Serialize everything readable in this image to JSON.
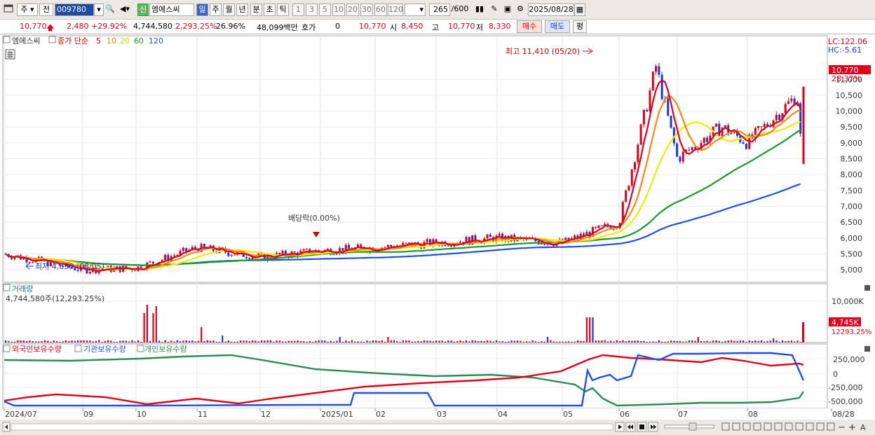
{
  "toolbar": {
    "period_sel": "주",
    "prev_label": "전",
    "stock_code": "009780",
    "badge_sin": "신",
    "stock_name": "엠에스씨",
    "periods": [
      "일",
      "주",
      "월",
      "년",
      "분",
      "초",
      "틱"
    ],
    "intervals": [
      "1",
      "3",
      "5",
      "10",
      "20",
      "30",
      "60",
      "120"
    ],
    "count": "265",
    "count_max": "/600",
    "date": "2025/08/28"
  },
  "quote": {
    "price": "10,770",
    "change": "2,480",
    "change_pct": "+29.92%",
    "volume": "4,744,580",
    "volume_pct": "2,293.25%",
    "turnover": "26.96%",
    "amount": "48,099백만",
    "hoga_label": "호가",
    "hoga_value": "0",
    "price2": "10,770",
    "open_label": "시",
    "open": "8,450",
    "high_label": "고",
    "high": "10,770",
    "low_label": "저",
    "low": "8,330",
    "buy_label": "매수",
    "sell_label": "매도",
    "eval_label": "평"
  },
  "price_panel": {
    "name": "엠에스씨",
    "ma_label": "종가 단순",
    "ma_periods": [
      "5",
      "10",
      "20",
      "60",
      "120"
    ],
    "lc": "LC:122.06",
    "hc": "HC:-5.61",
    "current_tag": "10,770",
    "current_pct": "28.37%",
    "high_note": "최고 11,410 (05/20)",
    "low_note": "최저 4,650 (08/05)",
    "dividend_note": "배당락(0.00%)"
  },
  "volume_panel": {
    "title": "거래량",
    "value": "4,744,580주(12,293.25%)",
    "current_tag": "4,745K",
    "current_pct": "12293.25%"
  },
  "holdings_panel": {
    "legends": [
      "외국인보유수량",
      "기관보유수량",
      "개인보유수량"
    ]
  },
  "x_axis": [
    "2024/07",
    "09",
    "10",
    "11",
    "12",
    "2025/01",
    "02",
    "03",
    "04",
    "05",
    "06",
    "07",
    "08",
    "08/28"
  ],
  "colors": {
    "ma5": "#e0001a",
    "ma10": "#f28a10",
    "ma20": "#f5e800",
    "ma60": "#1a9a2a",
    "ma120": "#2150e0",
    "up": "#e0001a",
    "down": "#1a37d8",
    "foreign": "#e0001a",
    "institution": "#2150e0",
    "individual": "#2e8b57"
  },
  "chart_data": [
    {
      "type": "candlestick",
      "title": "엠에스씨",
      "y_ticks": [
        5000,
        5500,
        6000,
        6500,
        7000,
        7500,
        8000,
        8500,
        9000,
        9500,
        10000,
        10500,
        11000
      ],
      "ylim": [
        4650,
        11800
      ],
      "close_points": [
        [
          "2024/07",
          5500
        ],
        [
          "2024/08",
          5000
        ],
        [
          "2024/09",
          5050
        ],
        [
          "2024/10",
          5700
        ],
        [
          "2024/11",
          5400
        ],
        [
          "2024/12",
          5600
        ],
        [
          "2025/01",
          5700
        ],
        [
          "2025/02",
          5850
        ],
        [
          "2025/03",
          6000
        ],
        [
          "2025/04",
          5850
        ],
        [
          "2025/05",
          6500
        ],
        [
          "2025/05/20",
          11410
        ],
        [
          "2025/06",
          8500
        ],
        [
          "2025/06/20",
          9500
        ],
        [
          "2025/07",
          9000
        ],
        [
          "2025/07/20",
          10500
        ],
        [
          "2025/08",
          8000
        ],
        [
          "2025/08/27",
          8290
        ],
        [
          "2025/08/28",
          10770
        ]
      ],
      "high": {
        "value": 11410,
        "date": "05/20"
      },
      "low": {
        "value": 4650,
        "date": "08/05"
      }
    },
    {
      "type": "bar",
      "title": "거래량",
      "y_ticks": [
        10000
      ],
      "y_tick_labels": [
        "10,000K"
      ],
      "last_value": 4744580
    },
    {
      "type": "line",
      "series_names": [
        "외국인보유수량",
        "기관보유수량",
        "개인보유수량"
      ],
      "y_ticks": [
        250000,
        0,
        -250000,
        -500000
      ],
      "y_tick_labels": [
        "250,000",
        "0",
        "-250,000",
        "-500,000"
      ]
    }
  ]
}
